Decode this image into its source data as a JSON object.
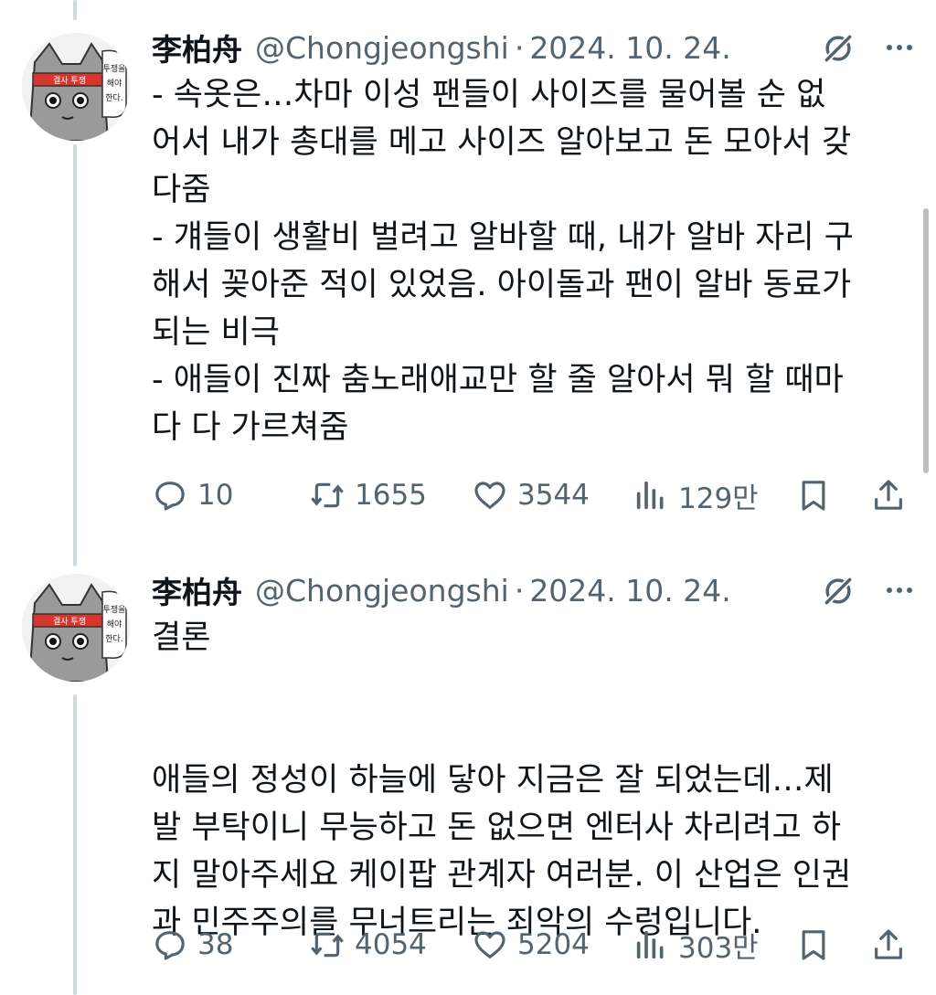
{
  "tweets": [
    {
      "author_name": "李柏舟",
      "handle": "@Chongjeongshi",
      "separator": "·",
      "date": "2024. 10. 24.",
      "avatar_text": [
        "투쟁을",
        "해야",
        "한다."
      ],
      "avatar_band_text": "결사 투쟁",
      "lines": [
        "- 속옷은…차마 이성 팬들이 사이즈를 물어볼 순 없",
        "어서 내가 총대를 메고 사이즈 알아보고 돈 모아서 갖",
        "다줌",
        "- 걔들이 생활비 벌려고 알바할 때, 내가 알바 자리 구",
        "해서 꽂아준 적이 있었음. 아이돌과 팬이 알바 동료가",
        "되는 비극",
        "- 애들이 진짜 춤노래애교만 할 줄 알아서 뭐 할 때마",
        "다 다 가르쳐줌"
      ],
      "replies": "10",
      "reposts": "1655",
      "likes": "3544",
      "views": "129만"
    },
    {
      "author_name": "李柏舟",
      "handle": "@Chongjeongshi",
      "separator": "·",
      "date": "2024. 10. 24.",
      "avatar_text": [
        "투쟁을",
        "해야",
        "한다."
      ],
      "avatar_band_text": "결사 투쟁",
      "lines": [
        "결론",
        "",
        "",
        "애들의 정성이 하늘에 닿아 지금은 잘 되었는데…제",
        "발 부탁이니 무능하고 돈 없으면 엔터사 차리려고 하",
        "지 말아주세요 케이팝 관계자 여러분. 이 산업은 인권",
        "과 민주주의를 무너트리는 죄악의 수렁입니다."
      ],
      "replies": "38",
      "reposts": "4054",
      "likes": "5204",
      "views": "303만"
    }
  ],
  "icons": {
    "reply": "reply-icon",
    "repost": "repost-icon",
    "like": "heart-icon",
    "views": "views-icon",
    "bookmark": "bookmark-icon",
    "share": "share-icon",
    "grok": "grok-icon",
    "more": "more-icon"
  },
  "colors": {
    "text": "#0f1419",
    "secondary": "#536471",
    "thread_line": "#cfd9de"
  }
}
